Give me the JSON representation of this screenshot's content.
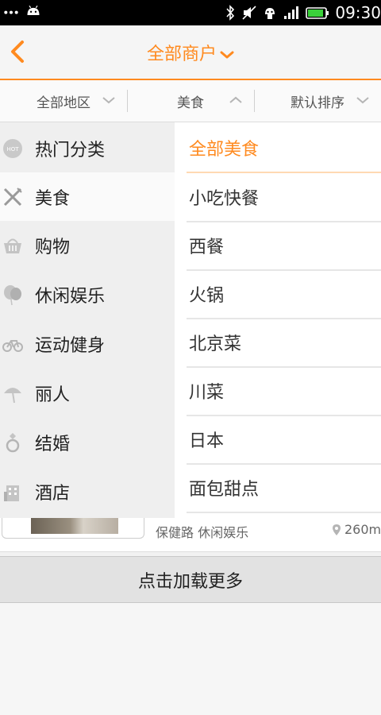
{
  "status_bar": {
    "time": "09:30"
  },
  "header": {
    "title": "全部商户"
  },
  "filters": [
    {
      "label": "全部地区",
      "direction": "down"
    },
    {
      "label": "美食",
      "direction": "up"
    },
    {
      "label": "默认排序",
      "direction": "down"
    }
  ],
  "categories": [
    {
      "label": "热门分类",
      "icon": "hot-icon"
    },
    {
      "label": "美食",
      "icon": "fork-knife-icon",
      "selected": true
    },
    {
      "label": "购物",
      "icon": "basket-icon"
    },
    {
      "label": "休闲娱乐",
      "icon": "balloon-icon"
    },
    {
      "label": "运动健身",
      "icon": "bicycle-icon"
    },
    {
      "label": "丽人",
      "icon": "umbrella-icon"
    },
    {
      "label": "结婚",
      "icon": "ring-icon"
    },
    {
      "label": "酒店",
      "icon": "building-icon"
    }
  ],
  "subcategories": [
    {
      "label": "全部美食",
      "selected": true
    },
    {
      "label": "小吃快餐"
    },
    {
      "label": "西餐"
    },
    {
      "label": "火锅"
    },
    {
      "label": "北京菜"
    },
    {
      "label": "川菜"
    },
    {
      "label": "日本"
    },
    {
      "label": "面包甜点"
    }
  ],
  "list_item": {
    "address": "保健路 休闲娱乐",
    "distance": "260m"
  },
  "load_more": {
    "label": "点击加载更多"
  },
  "colors": {
    "accent": "#ff8a1f"
  }
}
